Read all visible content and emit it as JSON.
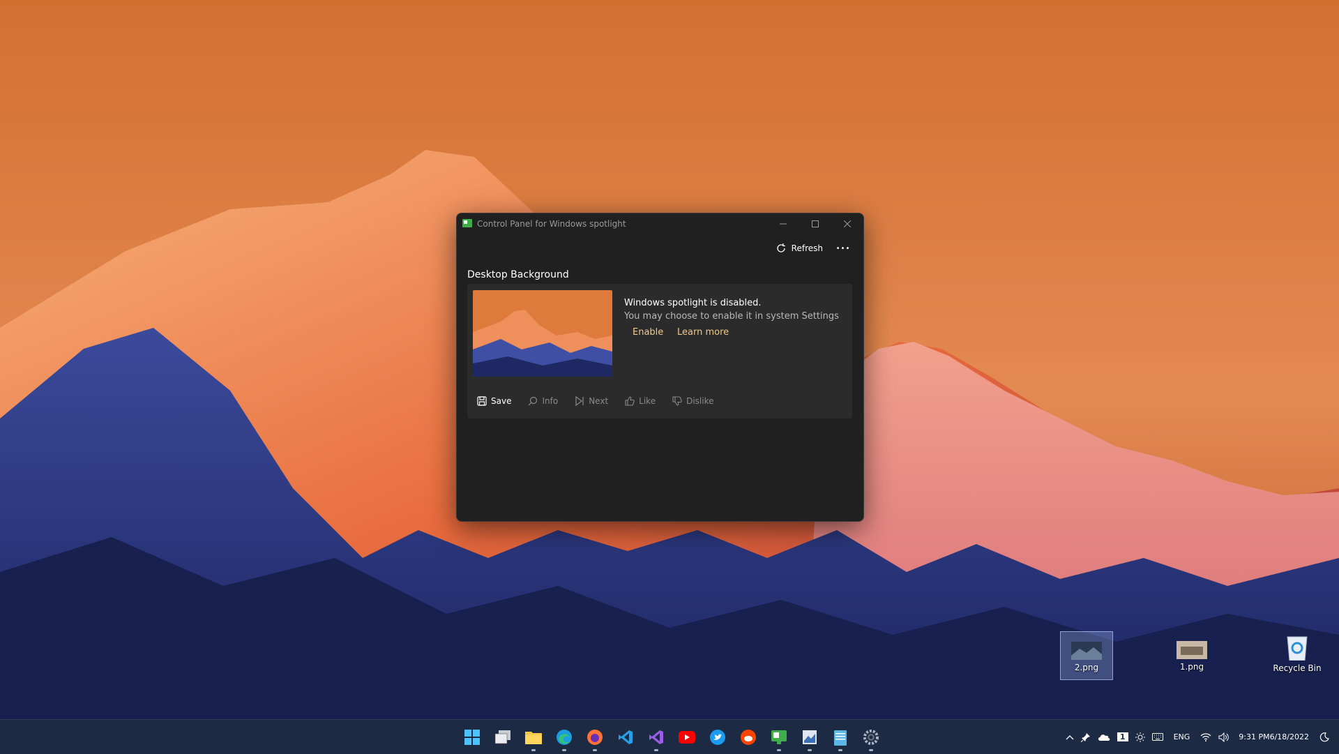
{
  "desktop": {
    "icons": [
      {
        "label": "2.png",
        "selected": true
      },
      {
        "label": "1.png",
        "selected": false
      },
      {
        "label": "Recycle Bin",
        "selected": false
      }
    ]
  },
  "window": {
    "title": "Control Panel for Windows spotlight",
    "toolbar": {
      "refresh_label": "Refresh",
      "more_label": "•••"
    },
    "section_title": "Desktop Background",
    "card": {
      "heading": "Windows spotlight is disabled.",
      "description": "You may choose to enable it in system Settings",
      "enable_label": "Enable",
      "learn_more_label": "Learn more"
    },
    "actions": {
      "save": "Save",
      "info": "Info",
      "next": "Next",
      "like": "Like",
      "dislike": "Dislike"
    }
  },
  "taskbar": {
    "apps": [
      {
        "name": "start-icon",
        "running": false
      },
      {
        "name": "task-view-icon",
        "running": false
      },
      {
        "name": "file-explorer-icon",
        "running": true
      },
      {
        "name": "edge-icon",
        "running": true
      },
      {
        "name": "firefox-icon",
        "running": true
      },
      {
        "name": "vscode-icon",
        "running": false
      },
      {
        "name": "visual-studio-icon",
        "running": true
      },
      {
        "name": "youtube-icon",
        "running": false
      },
      {
        "name": "twitter-icon",
        "running": false
      },
      {
        "name": "reddit-icon",
        "running": false
      },
      {
        "name": "spotlight-app-icon",
        "running": true
      },
      {
        "name": "photo-tool-icon",
        "running": true
      },
      {
        "name": "notepad-icon",
        "running": true
      },
      {
        "name": "settings-icon",
        "running": true
      }
    ],
    "tray": {
      "badge_number": "1",
      "language": "ENG",
      "time": "9:31 PM",
      "date": "6/18/2022"
    }
  },
  "colors": {
    "accent_link": "#f2c98a",
    "window_bg": "#202020",
    "card_bg": "#2b2b2b",
    "taskbar_bg": "#1c2a44"
  }
}
